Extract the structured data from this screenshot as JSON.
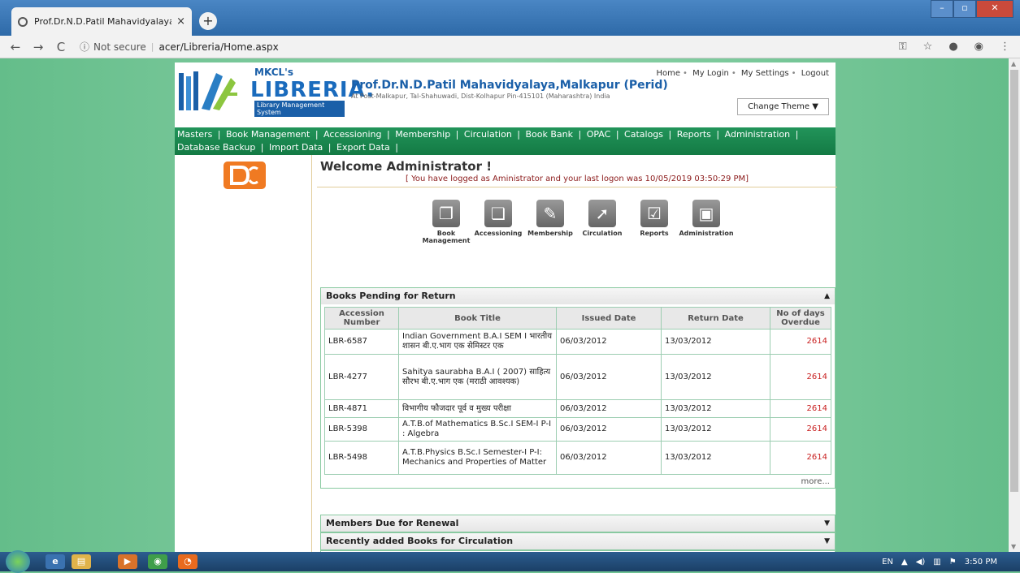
{
  "browser": {
    "tab_title": "Prof.Dr.N.D.Patil Mahavidyalaya,M",
    "tab_close": "×",
    "new_tab": "+",
    "security": "Not secure",
    "url": "acer/Libreria/Home.aspx"
  },
  "site": {
    "logo_mkcl": "MKCL's",
    "logo_libreria": "LIBRERIA.",
    "logo_subtitle": "Library Management System",
    "college_name": "Prof.Dr.N.D.Patil Mahavidyalaya,Malkapur (Perid)",
    "college_address": "At Post-Malkapur, Tal-Shahuwadi, Dist-Kolhapur Pin-415101 (Maharashtra) India",
    "top_links": [
      "Home",
      "My Login",
      "My Settings",
      "Logout"
    ],
    "change_theme": "Change Theme ▼",
    "menu": [
      "Masters",
      "Book Management",
      "Accessioning",
      "Membership",
      "Circulation",
      "Book Bank",
      "OPAC",
      "Catalogs",
      "Reports",
      "Administration",
      "Database Backup",
      "Import Data",
      "Export Data"
    ]
  },
  "main": {
    "welcome": "Welcome Administrator !",
    "logon_message": "[ You have logged as Aministrator and your last logon was 10/05/2019 03:50:29 PM]",
    "quick_icons": [
      {
        "label": "Book Management",
        "icon": "book-icon",
        "glyph": "❐"
      },
      {
        "label": "Accessioning",
        "icon": "accession-icon",
        "glyph": "❏"
      },
      {
        "label": "Membership",
        "icon": "membership-icon",
        "glyph": "✎"
      },
      {
        "label": "Circulation",
        "icon": "circulation-icon",
        "glyph": "➚"
      },
      {
        "label": "Reports",
        "icon": "reports-icon",
        "glyph": "☑"
      },
      {
        "label": "Administration",
        "icon": "administration-icon",
        "glyph": "▣"
      }
    ]
  },
  "pending_panel": {
    "title": "Books Pending for Return",
    "toggle": "▲",
    "columns": [
      "Accession Number",
      "Book Title",
      "Issued Date",
      "Return Date",
      "No of days Overdue"
    ],
    "rows": [
      {
        "acc": "LBR-6587",
        "title": "Indian Government B.A.I SEM I भारतीय शासन बी.ए.भाग एक सेमिस्टर एक",
        "issued": "06/03/2012",
        "return": "13/03/2012",
        "overdue": "2614"
      },
      {
        "acc": "LBR-4277",
        "title": "Sahitya saurabha B.A.I ( 2007) साहित्य सौरभ बी.ए.भाग एक (मराठी आवश्यक)",
        "issued": "06/03/2012",
        "return": "13/03/2012",
        "overdue": "2614"
      },
      {
        "acc": "LBR-4871",
        "title": "विभागीय फौजदार पूर्व व मुख्य परीक्षा",
        "issued": "06/03/2012",
        "return": "13/03/2012",
        "overdue": "2614"
      },
      {
        "acc": "LBR-5398",
        "title": "A.T.B.of Mathematics B.Sc.I SEM-I P-I : Algebra",
        "issued": "06/03/2012",
        "return": "13/03/2012",
        "overdue": "2614"
      },
      {
        "acc": "LBR-5498",
        "title": "A.T.B.Physics B.Sc.I Semester-I P-I: Mechanics and Properties of Matter",
        "issued": "06/03/2012",
        "return": "13/03/2012",
        "overdue": "2614"
      }
    ],
    "more": "more..."
  },
  "panels": {
    "members_due": "Members Due for Renewal",
    "recent_books": "Recently added Books for Circulation",
    "collapsed_toggle": "▼"
  },
  "taskbar": {
    "lang": "EN",
    "time": "3:50 PM"
  }
}
